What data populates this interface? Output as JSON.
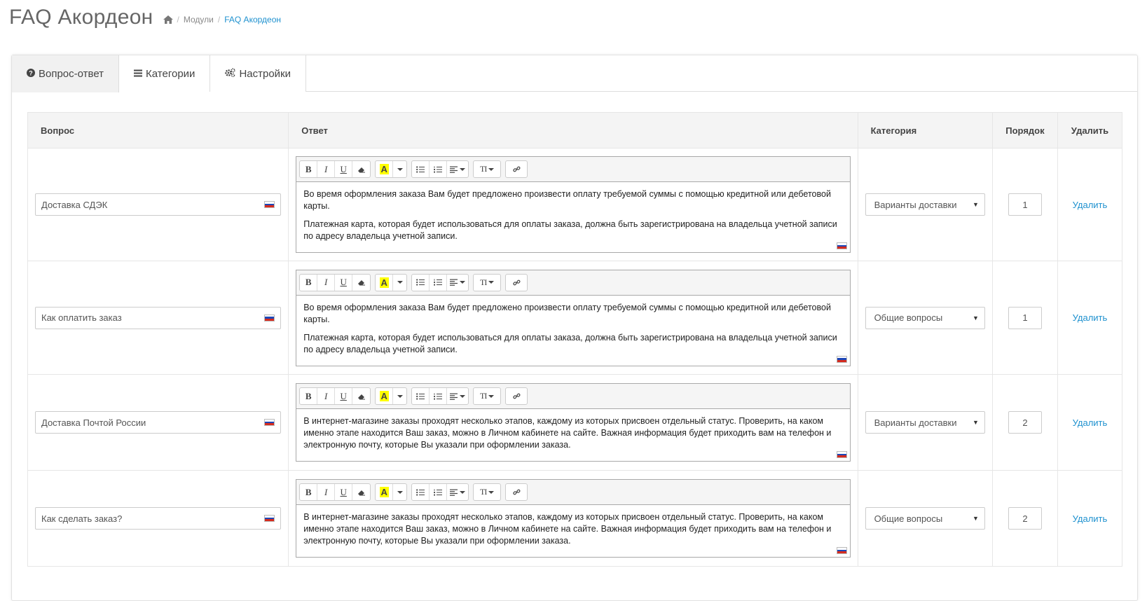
{
  "header": {
    "title": "FAQ Акордеон",
    "breadcrumb": [
      "Модули",
      "FAQ Акордеон"
    ]
  },
  "tabs": [
    {
      "label": "Вопрос-ответ",
      "icon": "question-circle-icon",
      "active": true
    },
    {
      "label": "Категории",
      "icon": "list-icon",
      "active": false
    },
    {
      "label": "Настройки",
      "icon": "cogs-icon",
      "active": false
    }
  ],
  "table": {
    "headers": {
      "question": "Вопрос",
      "answer": "Ответ",
      "category": "Категория",
      "order": "Порядок",
      "delete": "Удалить"
    },
    "rows": [
      {
        "question": "Доставка СДЭК",
        "answer": [
          "Во время оформления заказа Вам будет предложено произвести оплату требуемой суммы с помощью кредитной или дебетовой карты.",
          "Платежная карта, которая будет использоваться для оплаты заказа, должна быть зарегистрирована на владельца учетной записи по адресу владельца учетной записи."
        ],
        "category": "Варианты доставки",
        "order": "1",
        "delete": "Удалить"
      },
      {
        "question": "Как оплатить заказ",
        "answer": [
          "Во время оформления заказа Вам будет предложено произвести оплату требуемой суммы с помощью кредитной или дебетовой карты.",
          "Платежная карта, которая будет использоваться для оплаты заказа, должна быть зарегистрирована на владельца учетной записи по адресу владельца учетной записи."
        ],
        "category": "Общие вопросы",
        "order": "1",
        "delete": "Удалить"
      },
      {
        "question": "Доставка Почтой России",
        "answer": [
          "В интернет-магазине заказы проходят несколько этапов, каждому из которых присвоен отдельный статус. Проверить, на каком именно этапе находится Ваш заказ, можно в Личном кабинете на сайте. Важная информация будет приходить вам на телефон и электронную почту, которые Вы указали при оформлении заказа."
        ],
        "category": "Варианты доставки",
        "order": "2",
        "delete": "Удалить"
      },
      {
        "question": "Как сделать заказ?",
        "answer": [
          "В интернет-магазине заказы проходят несколько этапов, каждому из которых присвоен отдельный статус. Проверить, на каком именно этапе находится Ваш заказ, можно в Личном кабинете на сайте. Важная информация будет приходить вам на телефон и электронную почту, которые Вы указали при оформлении заказа."
        ],
        "category": "Общие вопросы",
        "order": "2",
        "delete": "Удалить"
      }
    ]
  },
  "editor_toolbar": {
    "bold": "B",
    "italic": "I",
    "underline": "U",
    "highlight": "A",
    "font_size": "TI"
  },
  "colors": {
    "link": "#1e91cf",
    "highlight": "#ffff00",
    "title": "#666666"
  }
}
